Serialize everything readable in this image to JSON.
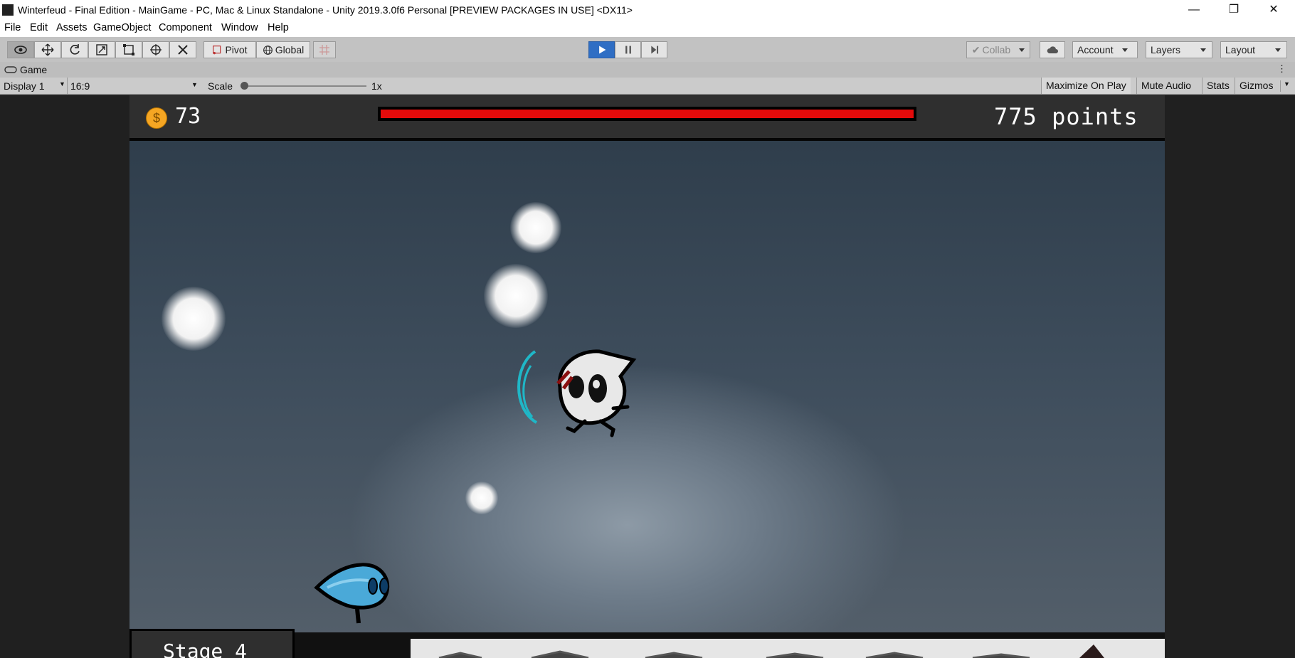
{
  "window": {
    "title": "Winterfeud - Final Edition - MainGame - PC, Mac & Linux Standalone - Unity 2019.3.0f6 Personal [PREVIEW PACKAGES IN USE] <DX11>",
    "minimize": "—",
    "maximize": "❐",
    "close": "✕"
  },
  "menubar": [
    "File",
    "Edit",
    "Assets",
    "GameObject",
    "Component",
    "Window",
    "Help"
  ],
  "toolbar": {
    "pivot_label": "Pivot",
    "global_label": "Global",
    "collab_label": "Collab",
    "account_label": "Account",
    "layers_label": "Layers",
    "layout_label": "Layout"
  },
  "game_tab": {
    "label": "Game",
    "display": "Display 1",
    "aspect": "16:9",
    "scale_label": "Scale",
    "scale_value": "1x",
    "maximize_on_play": "Maximize On Play",
    "mute_audio": "Mute Audio",
    "stats": "Stats",
    "gizmos": "Gizmos"
  },
  "hud": {
    "coins": "73",
    "coin_symbol": "$",
    "health_fraction": 1.0,
    "points": "775 points",
    "stage": "Stage 4"
  },
  "colors": {
    "health": "#e30b0b",
    "coin": "#f5a623",
    "player": "#4aa9d8",
    "enemy_swoosh": "#1fb7c7",
    "play_button": "#2f6ec4"
  }
}
